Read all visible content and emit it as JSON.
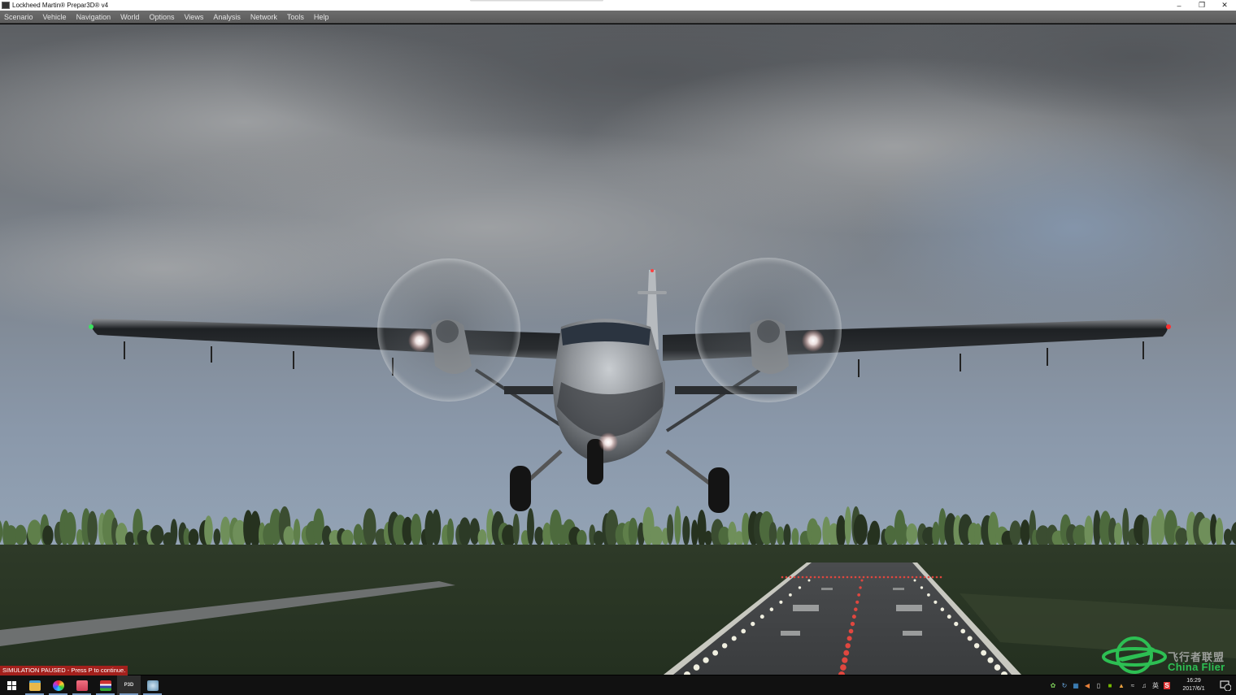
{
  "window": {
    "title": "Lockheed Martin® Prepar3D® v4",
    "controls": {
      "minimize": "–",
      "restore": "❐",
      "close": "✕"
    }
  },
  "menu": {
    "items": [
      {
        "label": "Scenario",
        "accel": "S"
      },
      {
        "label": "Vehicle",
        "accel": "h"
      },
      {
        "label": "Navigation",
        "accel": ""
      },
      {
        "label": "World",
        "accel": "W"
      },
      {
        "label": "Options",
        "accel": "O"
      },
      {
        "label": "Views",
        "accel": "V"
      },
      {
        "label": "Analysis",
        "accel": "A"
      },
      {
        "label": "Network",
        "accel": "N"
      },
      {
        "label": "Tools",
        "accel": "T"
      },
      {
        "label": "Help",
        "accel": "H"
      }
    ]
  },
  "scene": {
    "description": "Twin-engine turboprop aircraft (DHC-6 Twin Otter style) on approach over runway, overcast sky, tree line",
    "colors": {
      "sky_top": "#5f6266",
      "sky_mid": "#7d8590",
      "sky_horizon": "#8fa0b3",
      "grass": "#2f3d27",
      "runway": "#3d3f41",
      "runway_red_light": "#e0473f",
      "runway_edge_light": "#f0efe0",
      "nav_light_left": "#3ce060",
      "nav_light_right": "#ff3030"
    }
  },
  "status": {
    "paused_message": "SIMULATION PAUSED - Press P to continue."
  },
  "watermark": {
    "text_cn": "飞行者联盟",
    "text_en": "China Flier",
    "color": "#2dbf53"
  },
  "taskbar": {
    "start_icon": "windows-start-icon",
    "apps": [
      {
        "name": "file-explorer",
        "color": "#e8b84a",
        "running": true,
        "active": false
      },
      {
        "name": "color-wheel-app",
        "color": "#d9469a",
        "running": true,
        "active": false
      },
      {
        "name": "pink-app",
        "color": "#e05068",
        "running": true,
        "active": false
      },
      {
        "name": "flag-app",
        "color": "#4a5aa0",
        "running": true,
        "active": false
      },
      {
        "name": "p3d",
        "label": "P3D",
        "color": "#2e2e2e",
        "running": true,
        "active": true
      },
      {
        "name": "globe-app",
        "color": "#7aa8c8",
        "running": true,
        "active": false
      }
    ],
    "tray": {
      "icons": [
        "leaf",
        "network-sync",
        "bluetooth-like",
        "volume-arrow",
        "usb",
        "nvidia",
        "person-badge",
        "wifi",
        "speaker",
        "ime-en",
        "red-s"
      ],
      "ime_label": "英",
      "time": "16:29",
      "date": "2017/6/1",
      "notification_count": "1"
    }
  }
}
